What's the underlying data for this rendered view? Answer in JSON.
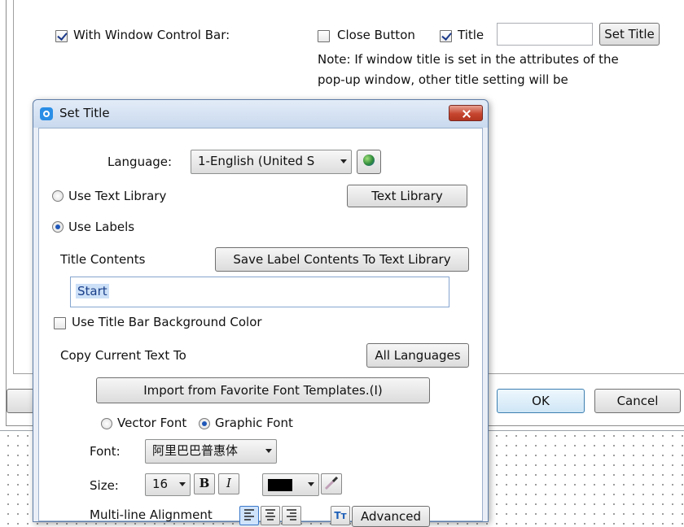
{
  "parent": {
    "with_window_control_bar_label": "With Window Control Bar:",
    "close_button_label": "Close Button",
    "title_label": "Title",
    "title_value": "",
    "set_title_button": "Set Title",
    "note_line1": "Note: If window title is set in the attributes of the",
    "note_line2": "pop-up window, other title setting will be",
    "ok_button": "OK",
    "cancel_button": "Cancel",
    "with_window_control_bar_checked": true,
    "close_button_checked": false,
    "title_checked": true
  },
  "dialog": {
    "title": "Set Title",
    "language_label": "Language:",
    "language_value": "1-English (United S",
    "use_text_library_label": "Use Text Library",
    "text_library_button": "Text Library",
    "use_labels_label": "Use Labels",
    "title_contents_label": "Title Contents",
    "save_label_button": "Save Label Contents To Text Library",
    "title_contents_value": "Start",
    "use_bg_color_label": "Use Title Bar Background Color",
    "copy_text_label": "Copy Current Text To",
    "all_languages_button": "All Languages",
    "import_button": "Import from Favorite Font Templates.(I)",
    "vector_font_label": "Vector Font",
    "graphic_font_label": "Graphic Font",
    "font_label": "Font:",
    "font_value": "阿里巴巴普惠体",
    "size_label": "Size:",
    "size_value": "16",
    "bold_label": "B",
    "italic_label": "I",
    "multiline_label": "Multi-line Alignment",
    "advanced_button": "Advanced",
    "tt_label": "Tт",
    "text_color": "#000000",
    "selected_radio": "use_labels",
    "selected_font_type": "graphic_font"
  }
}
